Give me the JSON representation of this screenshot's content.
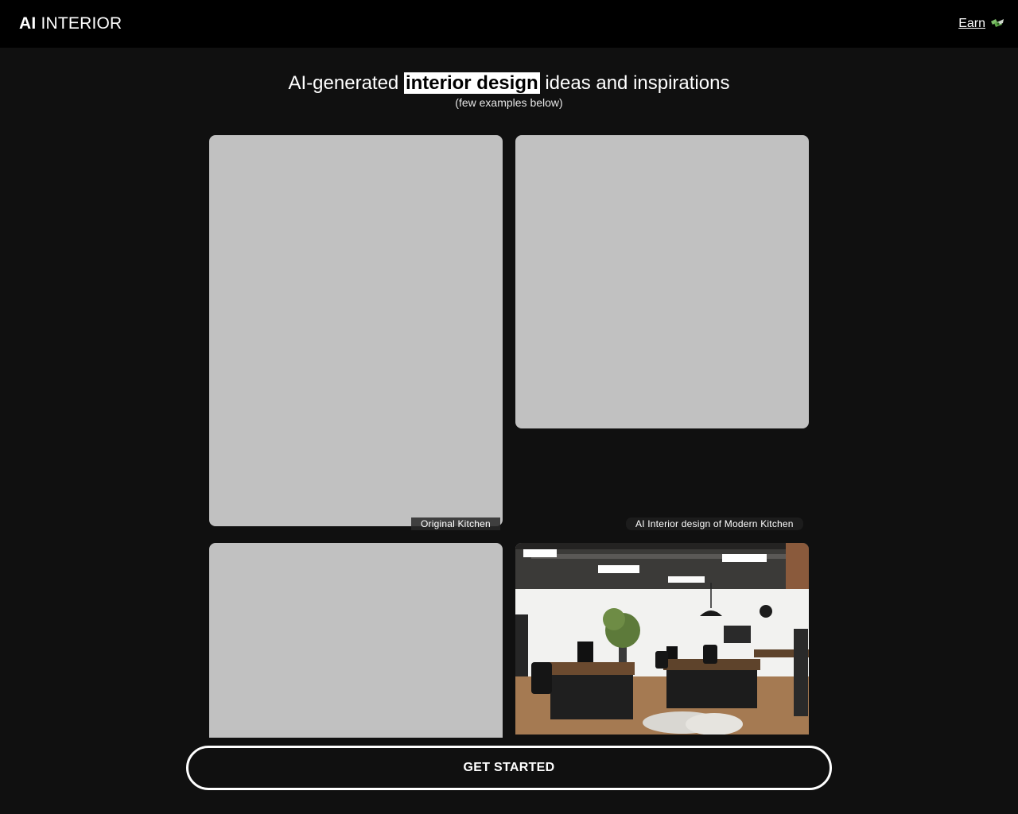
{
  "header": {
    "logo_bold": "AI",
    "logo_rest": "INTERIOR",
    "earn_label": "Earn"
  },
  "hero": {
    "title_before": "AI-generated",
    "title_highlight": "interior design",
    "title_after": "ideas and inspirations",
    "subtitle": "(few examples below)"
  },
  "gallery": {
    "captions": [
      "Original Kitchen",
      "AI Interior design of Modern Kitchen"
    ]
  },
  "cta": {
    "label": "GET STARTED"
  },
  "colors": {
    "background": "#101010",
    "topbar": "#000000",
    "placeholder": "#c1c1c1",
    "highlight": "#ffffff"
  },
  "icons": {
    "earn": "money-wings-icon"
  }
}
